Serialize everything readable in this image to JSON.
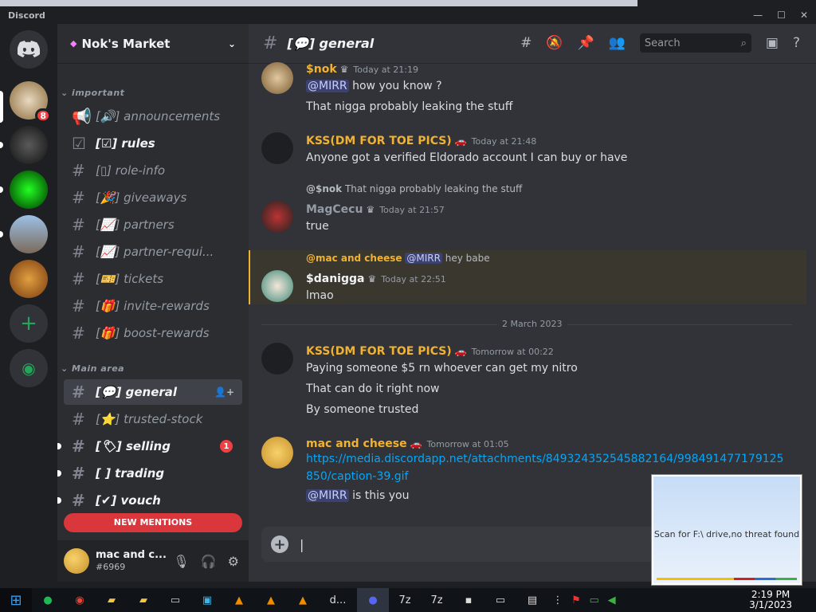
{
  "window": {
    "title": "Discord"
  },
  "server": {
    "name": "Nok's Market"
  },
  "guilds": {
    "badge": "8"
  },
  "categories": {
    "important": "important",
    "main": "Main area"
  },
  "channels": [
    {
      "icon": "[🔊]",
      "name": "announcements"
    },
    {
      "icon": "[☑]",
      "name": "rules"
    },
    {
      "icon": "[▯]",
      "name": "role-info"
    },
    {
      "icon": "[🎉]",
      "name": "giveaways"
    },
    {
      "icon": "[📈]",
      "name": "partners"
    },
    {
      "icon": "[📈]",
      "name": "partner-requi..."
    },
    {
      "icon": "[🎫]",
      "name": "tickets"
    },
    {
      "icon": "[🎁]",
      "name": "invite-rewards"
    },
    {
      "icon": "[🎁]",
      "name": "boost-rewards"
    },
    {
      "icon": "[💬]",
      "name": "general"
    },
    {
      "icon": "[⭐]",
      "name": "trusted-stock"
    },
    {
      "icon": "[🏷]",
      "name": "selling",
      "mention": "1"
    },
    {
      "icon": "[ ]",
      "name": "trading"
    },
    {
      "icon": "[✔]",
      "name": "vouch"
    }
  ],
  "new_mentions": "NEW MENTIONS",
  "user": {
    "name": "mac and c...",
    "tag": "#6969"
  },
  "header": {
    "channel": "[💬] general",
    "search": "Search"
  },
  "messages": [
    {
      "author": "$nok",
      "time": "Today at 21:19",
      "lines": [
        "@MIRR|how you know ?",
        "That nigga probably leaking the stuff"
      ],
      "color": "#f0b232"
    },
    {
      "author": "KSS(DM FOR TOE PICS)",
      "time": "Today at 21:48",
      "lines": [
        "Anyone got a verified Eldorado account I can buy or have"
      ],
      "color": "#f0b232"
    },
    {
      "reply_user": "@$nok",
      "reply_text": "That nigga probably leaking the stuff",
      "author": "MagCecu",
      "time": "Today at 21:57",
      "lines": [
        "true"
      ],
      "color": "#949ba4"
    },
    {
      "reply_user": "@mac and cheese",
      "reply_mention": "@MIRR",
      "reply_text": "hey babe",
      "author": "$danigga",
      "time": "Today at 22:51",
      "lines": [
        "lmao"
      ],
      "color": "#f2f3f5"
    },
    {
      "author": "KSS(DM FOR TOE PICS)",
      "time": "Tomorrow at 00:22",
      "lines": [
        "Paying someone $5 rn whoever can get my nitro",
        "That can do it right now",
        "By someone trusted"
      ],
      "color": "#f0b232"
    },
    {
      "author": "mac and cheese",
      "time": "Tomorrow at 01:05",
      "link1": "https://media.discordapp.net/attachments/849324352545882164/998491477179125",
      "link2": "850/caption-39.gif",
      "mention": "@MIRR",
      "after": "is this you",
      "color": "#f0b232"
    }
  ],
  "date_divider": "2 March 2023",
  "toast": {
    "text": "Scan for F:\\ drive,no threat found"
  },
  "clock": {
    "time": "2:19 PM",
    "date": "3/1/2023"
  },
  "taskbar": {
    "discord_label": "d..."
  }
}
